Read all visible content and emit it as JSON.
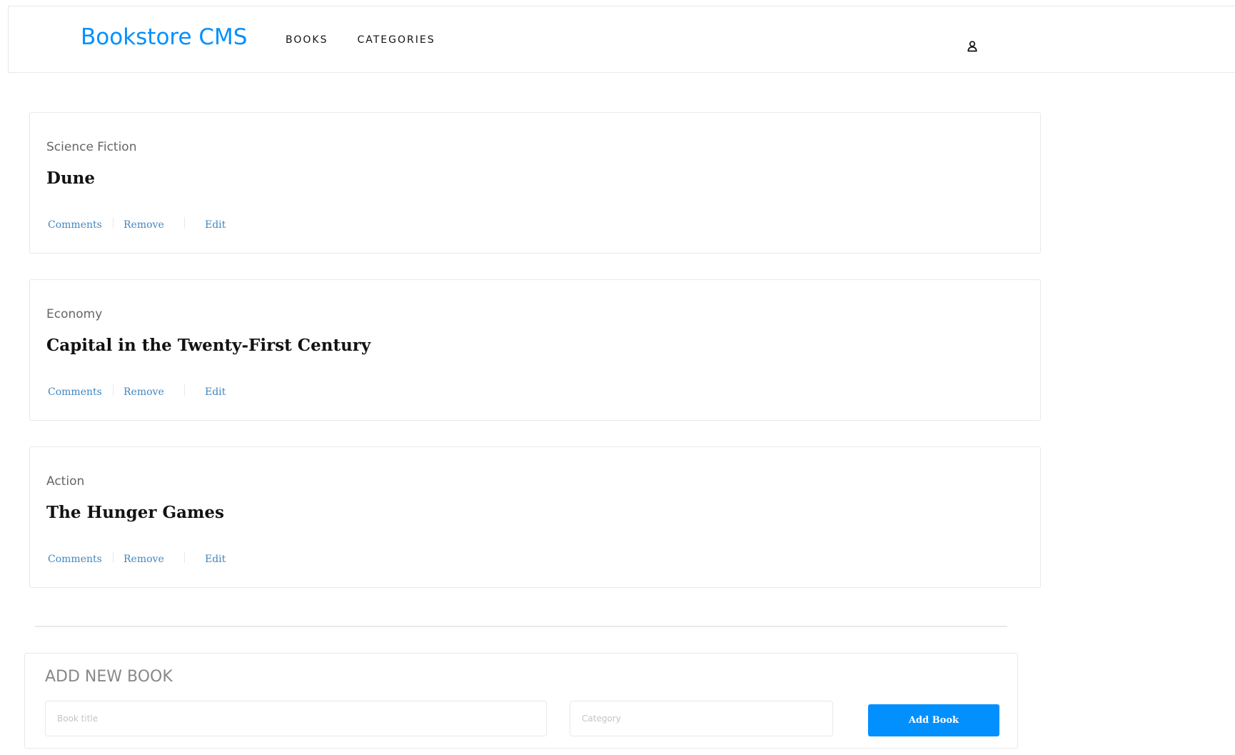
{
  "header": {
    "logo": "Bookstore CMS",
    "nav": [
      {
        "label": "BOOKS"
      },
      {
        "label": "CATEGORIES"
      }
    ],
    "user_icon": "user-icon",
    "accent_color": "#0290ff"
  },
  "books": [
    {
      "category": "Science Fiction",
      "title": "Dune",
      "actions": {
        "comments": "Comments",
        "remove": "Remove",
        "edit": "Edit"
      }
    },
    {
      "category": "Economy",
      "title": "Capital in the Twenty-First Century",
      "actions": {
        "comments": "Comments",
        "remove": "Remove",
        "edit": "Edit"
      }
    },
    {
      "category": "Action",
      "title": "The Hunger Games",
      "actions": {
        "comments": "Comments",
        "remove": "Remove",
        "edit": "Edit"
      }
    }
  ],
  "form": {
    "heading": "ADD NEW BOOK",
    "title_placeholder": "Book title",
    "title_value": "",
    "category_placeholder": "Category",
    "category_value": "",
    "submit_label": "Add Book"
  }
}
